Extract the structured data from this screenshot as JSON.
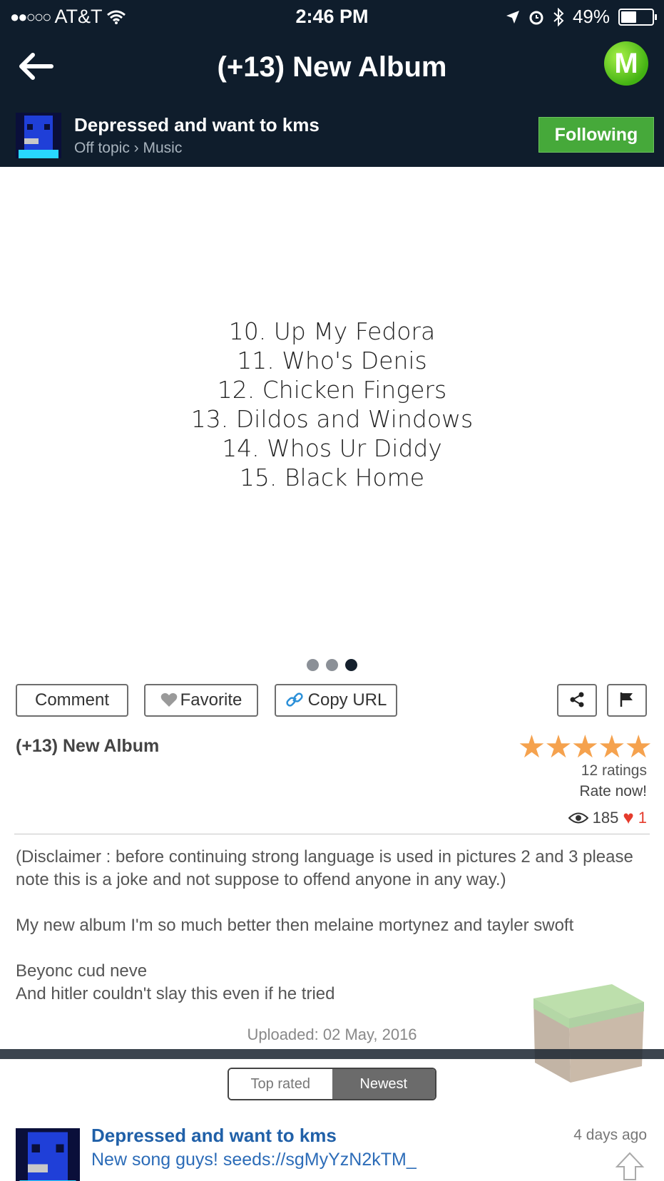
{
  "status_bar": {
    "carrier": "AT&T",
    "time": "2:46 PM",
    "battery": "49%",
    "battery_level": 0.49
  },
  "navbar": {
    "title": "(+13) New Album",
    "logo_letter": "M"
  },
  "channel": {
    "name": "Depressed and want to kms",
    "breadcrumb": "Off topic › Music",
    "follow_label": "Following"
  },
  "image": {
    "tracks": [
      "10. Up My Fedora",
      "11. Who's Denis",
      "12. Chicken Fingers",
      "13. Dildos and Windows",
      "14. Whos Ur Diddy",
      "15. Black Home"
    ],
    "page_count": 3,
    "active_page": 3
  },
  "actions": {
    "comment": "Comment",
    "favorite": "Favorite",
    "copy_url": "Copy URL"
  },
  "post": {
    "title": "(+13) New Album",
    "stars": 5,
    "ratings": "12 ratings",
    "rate_now": "Rate now!",
    "views": "185",
    "likes": "1",
    "description": [
      "(Disclaimer : before continuing strong language is used in pictures 2 and 3 please note this is a joke and not suppose to offend anyone in any way.)",
      "My new album I'm so much better then melaine mortynez and tayler swoft",
      "Beyonc cud neve",
      "And hitler couldn't slay this even if he tried"
    ],
    "uploaded": "Uploaded: 02 May, 2016"
  },
  "sort_tabs": {
    "top_rated": "Top rated",
    "newest": "Newest",
    "active": "Newest"
  },
  "comment": {
    "author": "Depressed and want to kms",
    "text": "New song guys! seeds://sgMyYzN2kTM_",
    "time": "4 days ago"
  },
  "colors": {
    "header_bg": "#0f1d2c",
    "follow_green": "#46a93a",
    "star_orange": "#f5a24e",
    "link_blue": "#2060a8",
    "heart_red": "#e53b2c"
  }
}
